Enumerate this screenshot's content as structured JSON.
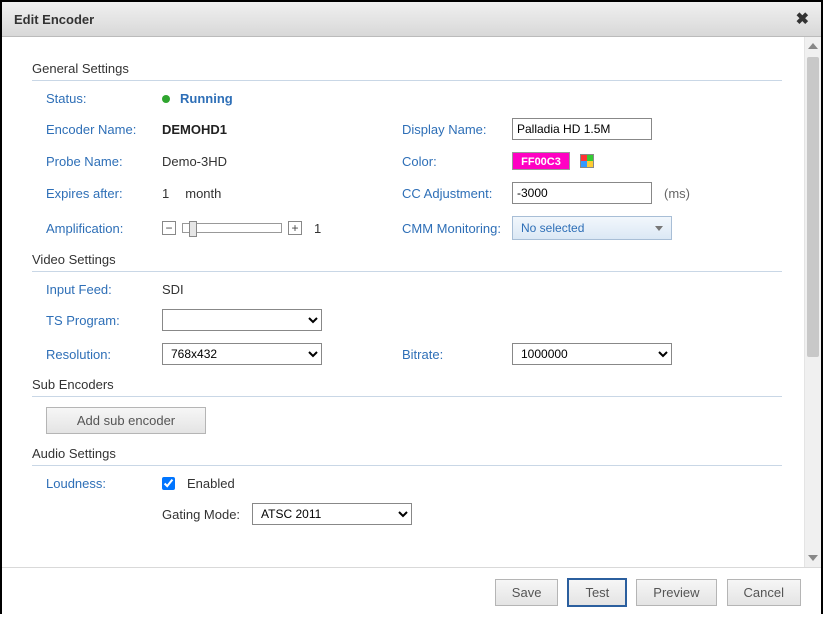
{
  "dialog": {
    "title": "Edit Encoder"
  },
  "sections": {
    "general": "General Settings",
    "video": "Video Settings",
    "sub": "Sub Encoders",
    "audio": "Audio Settings"
  },
  "labels": {
    "status": "Status:",
    "encoder_name": "Encoder Name:",
    "probe_name": "Probe Name:",
    "expires": "Expires after:",
    "amplification": "Amplification:",
    "display_name": "Display Name:",
    "color": "Color:",
    "cc_adjust": "CC Adjustment:",
    "cmm": "CMM Monitoring:",
    "input_feed": "Input Feed:",
    "ts_program": "TS Program:",
    "resolution": "Resolution:",
    "bitrate": "Bitrate:",
    "loudness": "Loudness:",
    "gating": "Gating Mode:"
  },
  "values": {
    "status": "Running",
    "encoder_name": "DEMOHD1",
    "probe_name": "Demo-3HD",
    "expires_num": "1",
    "expires_unit": "month",
    "amplification": "1",
    "display_name": "Palladia HD 1.5M",
    "color_hex": "FF00C3",
    "cc_adjust": "-3000",
    "cc_unit": "(ms)",
    "cmm": "No selected",
    "input_feed": "SDI",
    "ts_program": "",
    "resolution": "768x432",
    "bitrate": "1000000",
    "loudness_enabled_label": "Enabled",
    "gating": "ATSC 2011"
  },
  "buttons": {
    "add_sub": "Add sub encoder",
    "save": "Save",
    "test": "Test",
    "preview": "Preview",
    "cancel": "Cancel"
  }
}
